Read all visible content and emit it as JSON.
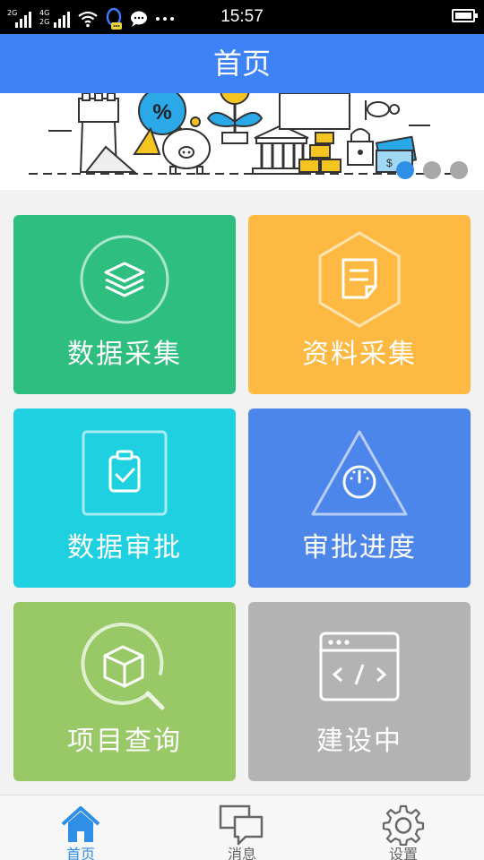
{
  "status_bar": {
    "sim1_tag": "2G",
    "sim2_tag": "4G",
    "sim2b_tag": "2G",
    "time": "15:57",
    "icons": [
      "signal-icon",
      "wifi-icon",
      "qq-icon",
      "message-icon",
      "more-icon",
      "battery-icon"
    ]
  },
  "header": {
    "title": "首页"
  },
  "banner": {
    "slide_count": 3,
    "active_slide": 1
  },
  "tiles": [
    {
      "label": "数据采集",
      "color": "#2ebf80",
      "icon": "layers-icon"
    },
    {
      "label": "资料采集",
      "color": "#fdb942",
      "icon": "document-edit-icon"
    },
    {
      "label": "数据审批",
      "color": "#1fd0e0",
      "icon": "clipboard-check-icon"
    },
    {
      "label": "审批进度",
      "color": "#4d86ea",
      "icon": "gauge-icon"
    },
    {
      "label": "项目查询",
      "color": "#99c966",
      "icon": "box-search-icon"
    },
    {
      "label": "建设中",
      "color": "#b3b3b3",
      "icon": "code-window-icon"
    }
  ],
  "tabs": [
    {
      "label": "首页",
      "icon": "home-icon",
      "active": true
    },
    {
      "label": "消息",
      "icon": "chat-icon",
      "active": false
    },
    {
      "label": "设置",
      "icon": "gear-icon",
      "active": false
    }
  ],
  "colors": {
    "primary": "#3e82f7",
    "tab_active": "#2f8fe6"
  }
}
